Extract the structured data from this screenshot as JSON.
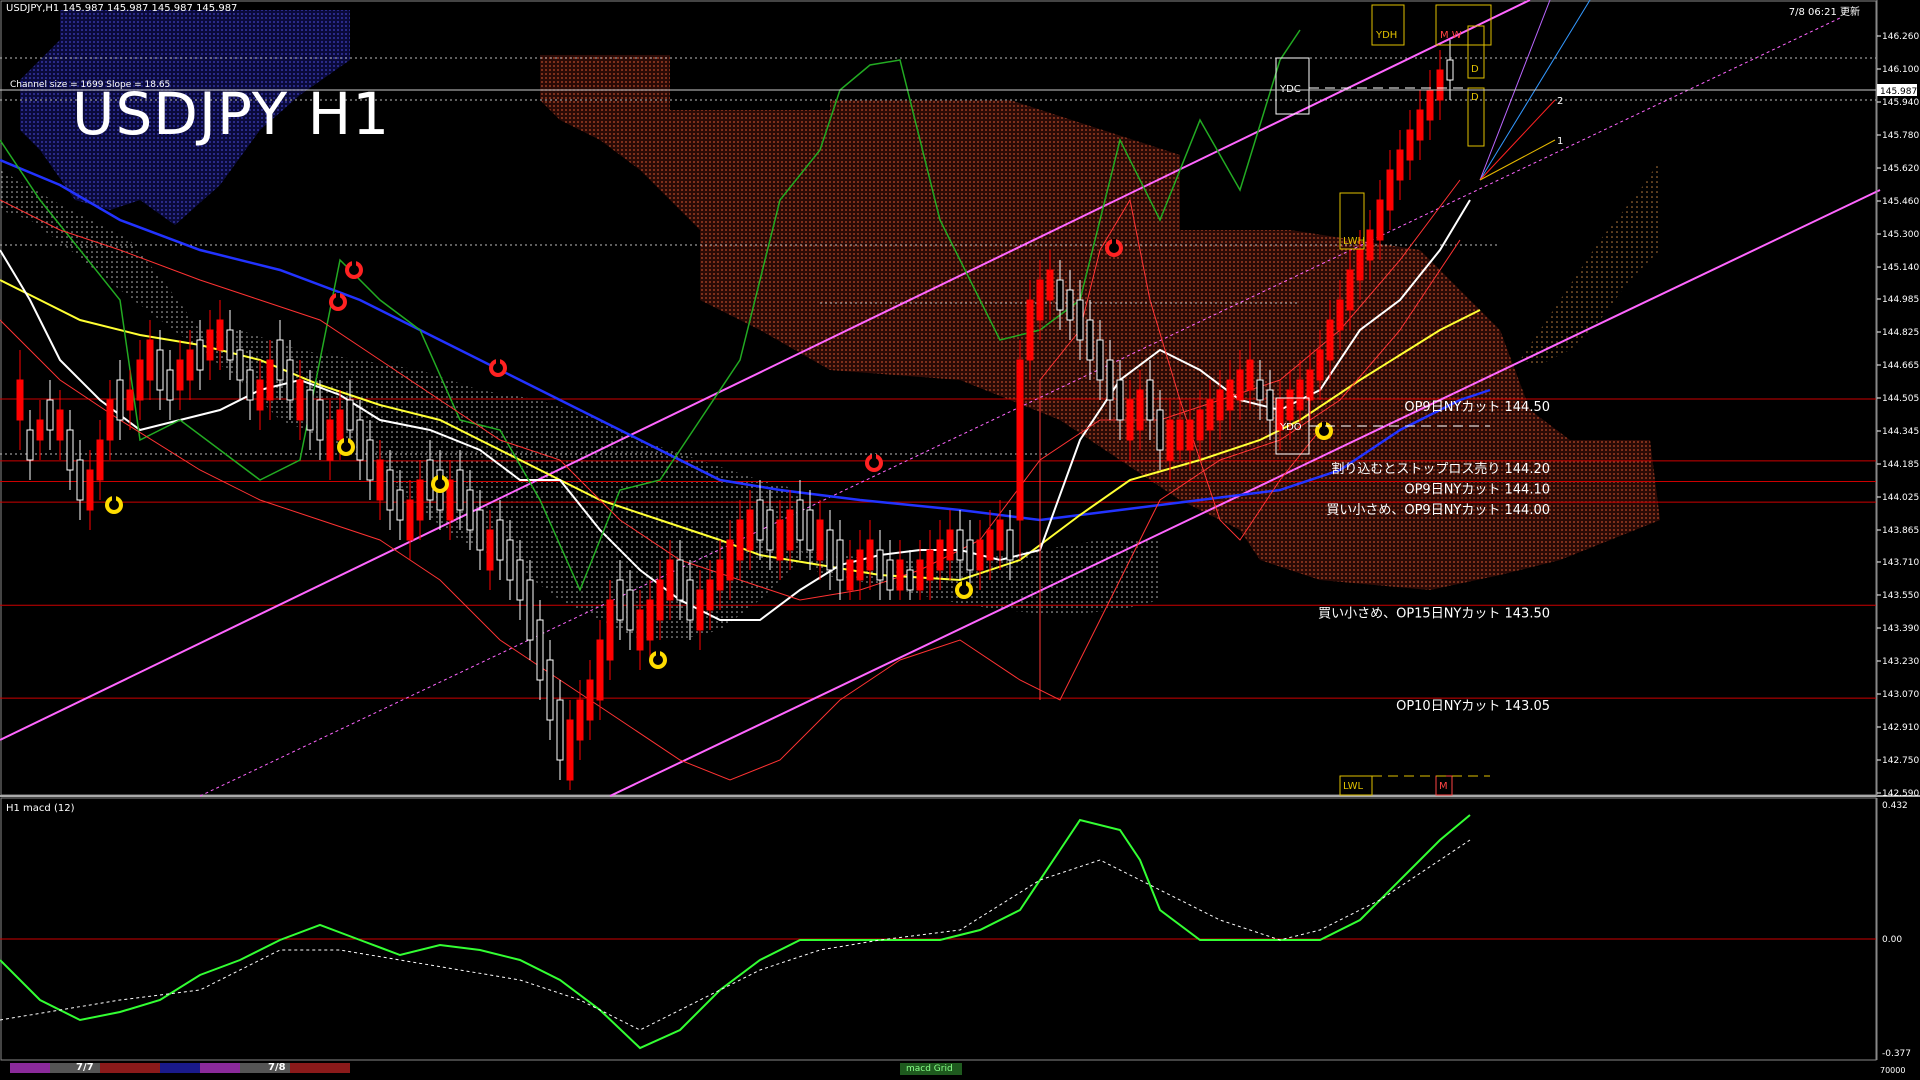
{
  "header": {
    "symbol_info": "USDJPY,H1  145.987 145.987 145.987 145.987",
    "clock": "7/8 06:21 更新",
    "channel_info": "Channel size = 1699 Slope = 18.65",
    "title": "USDJPY H1",
    "subwindow_title": "H1  macd (12)"
  },
  "colors": {
    "background": "#000000",
    "bull_candle": "#ffffff",
    "bear_candle": "#ff0000",
    "channel": "#ff66ff",
    "kumo_red": "#8b2a1a",
    "kumo_blue": "#3030a0",
    "sma_short": "#ffffff",
    "sma_mid": "#ffff33",
    "sma_long": "#2233ff",
    "chikou": "#22aa22",
    "macd_up": "#33ff33",
    "macd_down": "#ff88aa",
    "level_line": "#cc0000"
  },
  "price_axis": {
    "ticks": [
      "146.260",
      "146.100",
      "145.940",
      "145.780",
      "145.620",
      "145.460",
      "145.300",
      "145.140",
      "144.985",
      "144.825",
      "144.665",
      "144.505",
      "144.345",
      "144.185",
      "144.025",
      "143.865",
      "143.710",
      "143.550",
      "143.390",
      "143.230",
      "143.070",
      "142.910",
      "142.750",
      "142.590"
    ],
    "current_price": "145.987"
  },
  "macd_axis": {
    "ticks": [
      "0.432",
      "0.00",
      "-0.377"
    ]
  },
  "level_notes": [
    {
      "text": "OP9日NYカット 144.50",
      "price": 144.5
    },
    {
      "text": "割り込むとストップロス売り 144.20",
      "price": 144.2
    },
    {
      "text": "OP9日NYカット 144.10",
      "price": 144.1
    },
    {
      "text": "買い小さめ、OP9日NYカット 144.00",
      "price": 144.0
    },
    {
      "text": "買い小さめ、OP15日NYカット 143.50",
      "price": 143.5
    },
    {
      "text": "OP10日NYカット 143.05",
      "price": 143.05
    }
  ],
  "box_labels": {
    "ydh": "YDH",
    "ydc": "YDC",
    "ydo": "YDO",
    "lwh": "LWH",
    "lwl": "LWL",
    "m": "M",
    "mw": "M W",
    "d_top": "D",
    "d_mid": "D",
    "line_1": "1",
    "line_2": "2"
  },
  "time_axis": {
    "date_1": "7/7",
    "date_2": "7/8",
    "macd_tag": "macd Grid",
    "bottom_value": "70000"
  }
}
